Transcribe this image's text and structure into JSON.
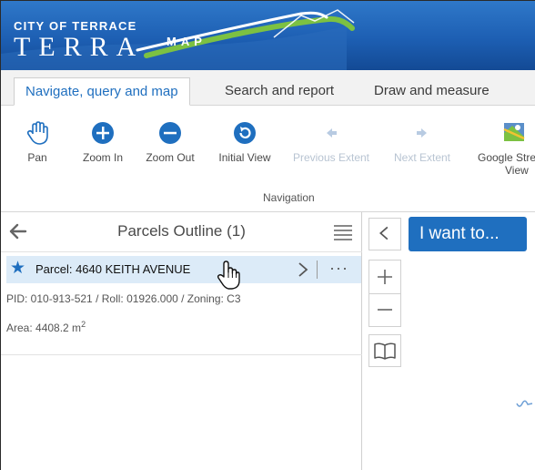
{
  "banner": {
    "city_text": "CITY OF TERRACE",
    "terra_text": "TERRA",
    "map_text": "MAP",
    "colors": {
      "sky_top": "#2f78c9",
      "sky_bottom": "#134a95",
      "hill_green": "#7cc142",
      "ribbon_white": "#ffffff"
    }
  },
  "tabs": [
    {
      "label": "Navigate, query and map",
      "active": true
    },
    {
      "label": "Search and report",
      "active": false
    },
    {
      "label": "Draw and measure",
      "active": false
    }
  ],
  "ribbon": {
    "tools": [
      {
        "label": "Pan",
        "icon": "hand-pan-icon",
        "enabled": true
      },
      {
        "label": "Zoom In",
        "icon": "zoom-in-icon",
        "enabled": true
      },
      {
        "label": "Zoom Out",
        "icon": "zoom-out-icon",
        "enabled": true
      },
      {
        "label": "Initial View",
        "icon": "initial-view-icon",
        "enabled": true
      },
      {
        "label": "Previous Extent",
        "icon": "arrow-left-icon",
        "enabled": false
      },
      {
        "label": "Next Extent",
        "icon": "arrow-right-icon",
        "enabled": false
      },
      {
        "label": "Google Stre",
        "label2": "View",
        "icon": "street-view-icon",
        "enabled": true
      }
    ],
    "group_label": "Navigation"
  },
  "panel": {
    "title": "Parcels Outline (1)",
    "result": {
      "title": "Parcel: 4640 KEITH AVENUE",
      "pid_line": "PID: 010-913-521 / Roll: 01926.000 / Zoning: C3",
      "area_line": "Area: 4408.2 m",
      "area_sup": "2",
      "more": "···"
    }
  },
  "map": {
    "collapse_icon": "chevron-left-icon",
    "i_want_to": "I want to...",
    "accent": "#1f6fbf"
  }
}
